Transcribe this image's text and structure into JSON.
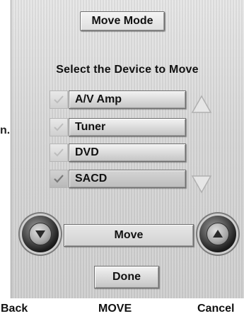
{
  "edge_fragment": "n.",
  "header": {
    "title": "Move Mode"
  },
  "prompt": "Select the Device to Move",
  "devices": [
    {
      "label": "A/V Amp",
      "checked": false
    },
    {
      "label": "Tuner",
      "checked": false
    },
    {
      "label": "DVD",
      "checked": false
    },
    {
      "label": "SACD",
      "checked": true
    }
  ],
  "move_field": {
    "value": "Move"
  },
  "done_label": "Done",
  "bottom_bar": {
    "left": "Back",
    "center": "MOVE",
    "right": "Cancel"
  },
  "icons": {
    "scroll_up": "triangle-up-icon",
    "scroll_down": "triangle-down-icon",
    "move_down": "round-down-arrow-icon",
    "move_up": "round-up-arrow-icon",
    "check": "check-mark-icon"
  }
}
